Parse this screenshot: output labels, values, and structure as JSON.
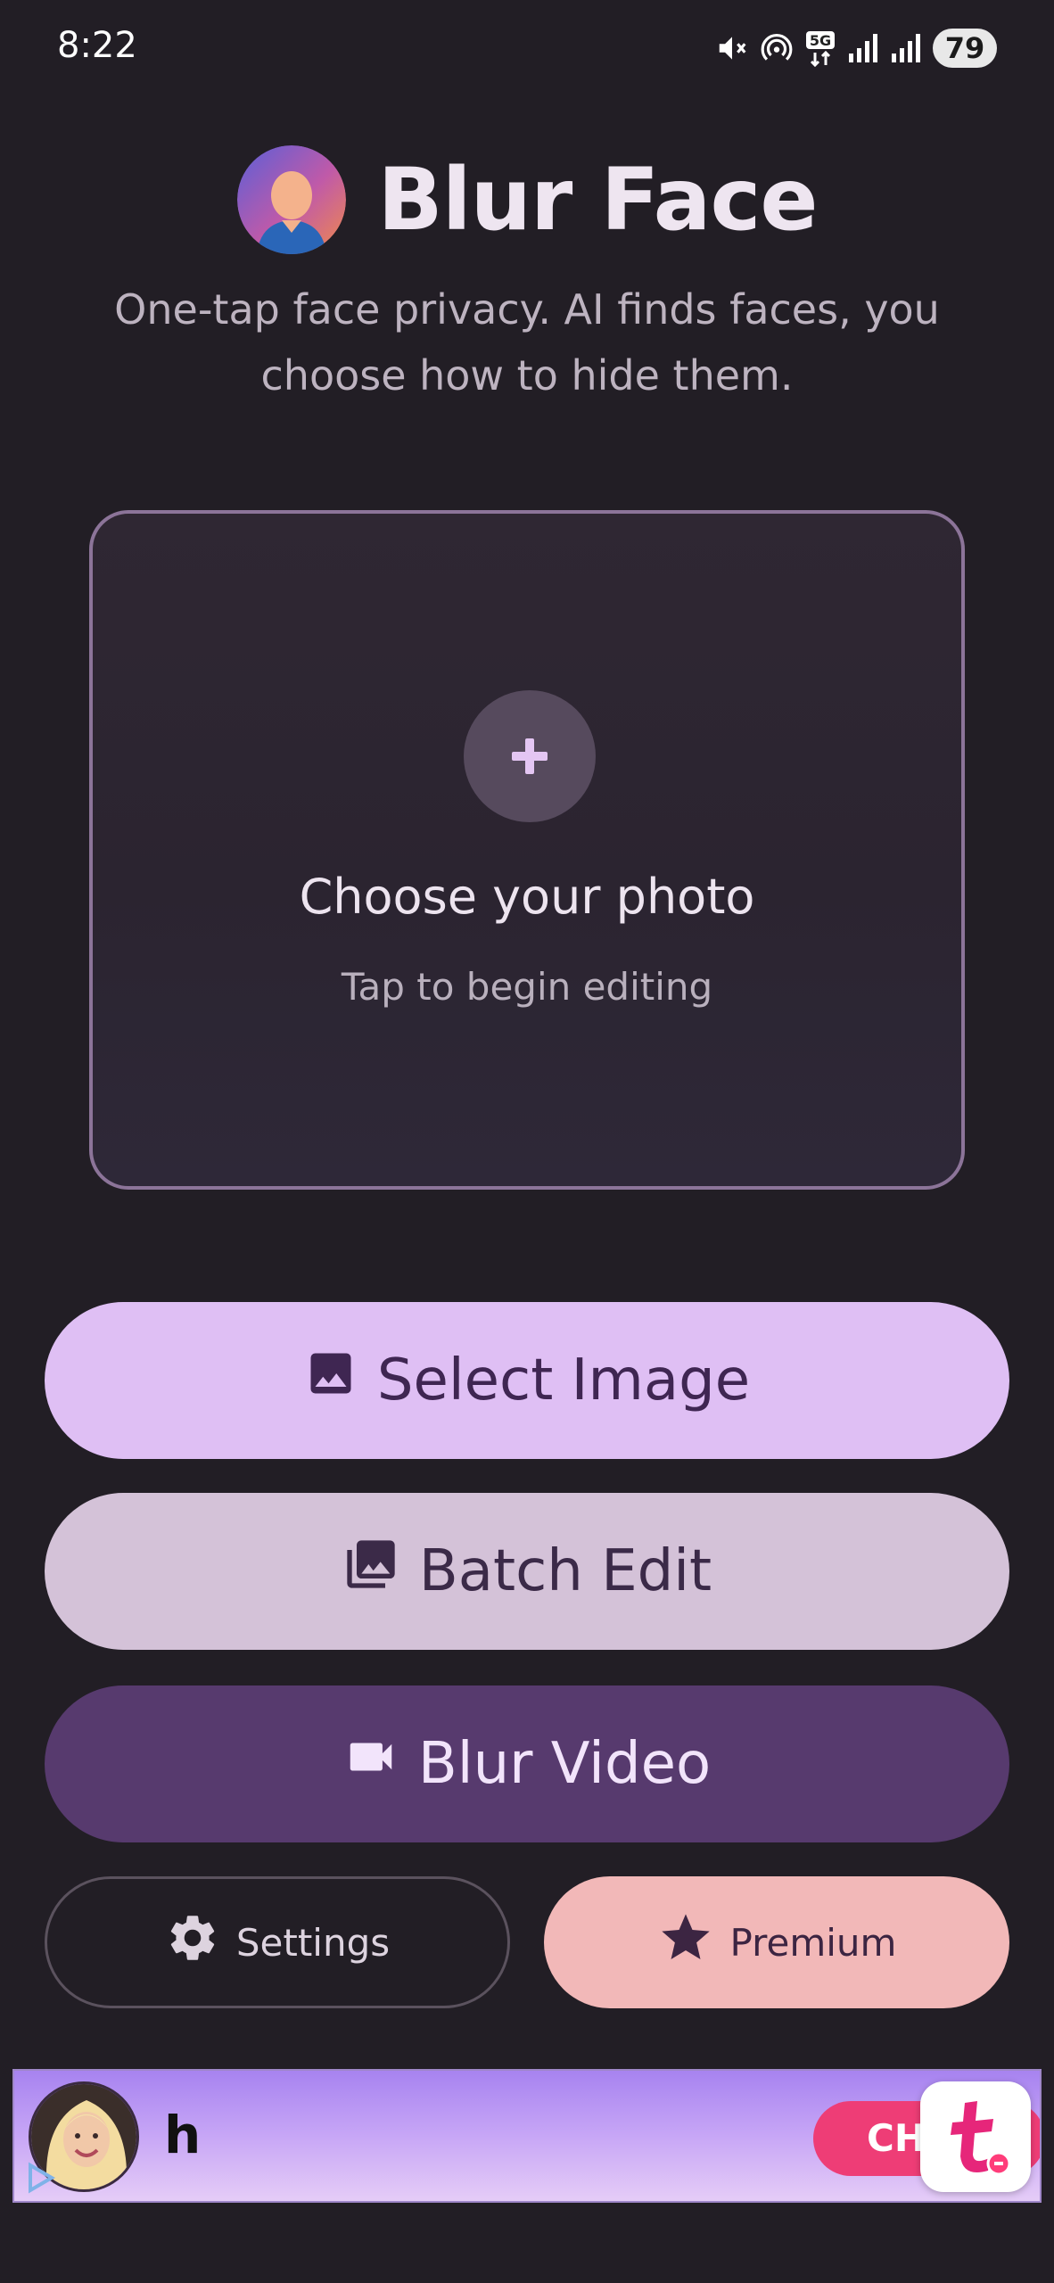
{
  "status_bar": {
    "time": "8:22",
    "battery": "79"
  },
  "header": {
    "title": "Blur Face",
    "subtitle": "One-tap face privacy. AI finds faces, you choose how to hide them."
  },
  "upload_card": {
    "title": "Choose your photo",
    "hint": "Tap to begin editing",
    "add_glyph": "+"
  },
  "buttons": {
    "select_image": "Select Image",
    "batch_edit": "Batch Edit",
    "blur_video": "Blur Video",
    "settings": "Settings",
    "premium": "Premium"
  },
  "ad": {
    "title": "h",
    "cta": "CH"
  },
  "icons": {
    "select_image": "image-icon",
    "batch_edit": "photo-library-icon",
    "blur_video": "videocam-icon",
    "settings": "gear-icon",
    "premium": "star-icon"
  },
  "colors": {
    "background": "#221e25",
    "primary_container": "#dfbff4",
    "secondary_container": "#d4c2d8",
    "primary": "#573a6e",
    "premium": "#f2b8b8",
    "card_border": "#8c7499"
  }
}
